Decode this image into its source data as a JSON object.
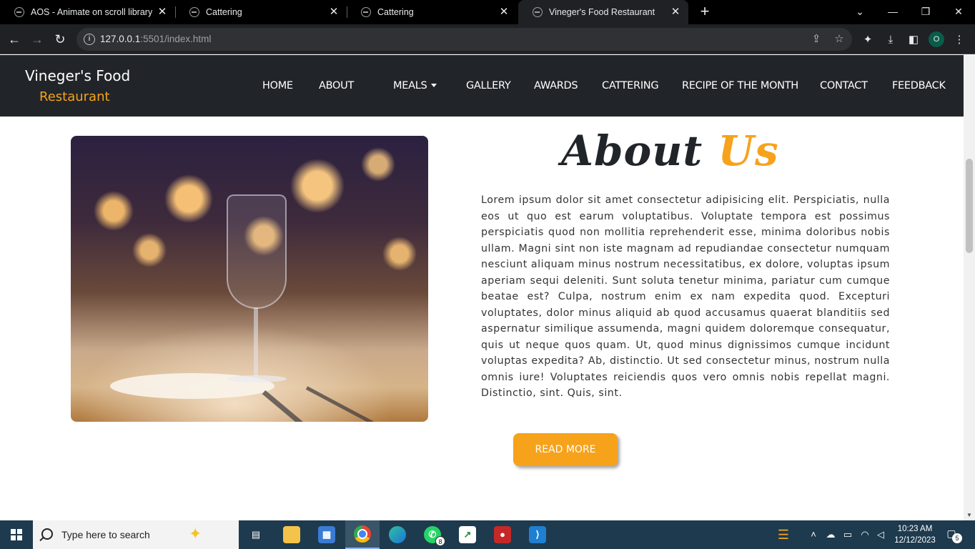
{
  "browser": {
    "tabs": [
      {
        "title": "AOS - Animate on scroll library",
        "active": false
      },
      {
        "title": "Cattering",
        "active": false
      },
      {
        "title": "Cattering",
        "active": false
      },
      {
        "title": "Vineger's Food Restaurant",
        "active": true
      }
    ],
    "new_tab": "+",
    "url_host": "127.0.0.1",
    "url_rest": ":5501/index.html",
    "profile_initial": "O"
  },
  "site": {
    "brand_line1": "Vineger's Food",
    "brand_line2": "Restaurant",
    "nav": [
      "HOME",
      "ABOUT",
      "MEALS",
      "GALLERY",
      "AWARDS",
      "CATTERING",
      "RECIPE OF THE MONTH",
      "CONTACT",
      "FEEDBACK"
    ],
    "about_title_main": "About",
    "about_title_accent": "Us",
    "about_text": "Lorem ipsum dolor sit amet consectetur adipisicing elit. Perspiciatis, nulla eos ut quo est earum voluptatibus. Voluptate tempora est possimus perspiciatis quod non mollitia reprehenderit esse, minima doloribus nobis ullam. Magni sint non iste magnam ad repudiandae consectetur numquam nesciunt aliquam minus nostrum necessitatibus, ex dolore, voluptas ipsum aperiam sequi deleniti. Sunt soluta tenetur minima, pariatur cum cumque beatae est? Culpa, nostrum enim ex nam expedita quod. Excepturi voluptates, dolor minus aliquid ab quod accusamus quaerat blanditiis sed aspernatur similique assumenda, magni quidem doloremque consequatur, quis ut neque quos quam. Ut, quod minus dignissimos cumque incidunt voluptas expedita? Ab, distinctio. Ut sed consectetur minus, nostrum nulla omnis iure! Voluptates reiciendis quos vero omnis nobis repellat magni. Distinctio, sint. Quis, sint.",
    "read_more": "READ MORE",
    "accent_color": "#f7a21b",
    "nav_bg": "#212529"
  },
  "taskbar": {
    "search_placeholder": "Type here to search",
    "whatsapp_badge": "8",
    "time": "10:23 AM",
    "date": "12/12/2023",
    "notification_count": "5"
  }
}
